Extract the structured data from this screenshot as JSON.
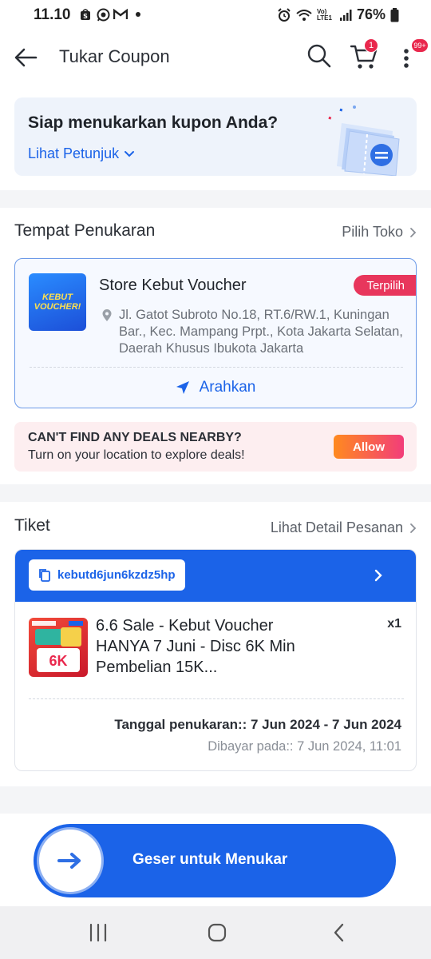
{
  "status_bar": {
    "time": "11.10",
    "battery": "76%",
    "network_label": "Vo) LTE1"
  },
  "header": {
    "title": "Tukar Coupon",
    "cart_badge": "1",
    "more_badge": "99+"
  },
  "hero": {
    "title": "Siap menukarkan kupon Anda?",
    "link": "Lihat Petunjuk"
  },
  "store_section": {
    "title": "Tempat Penukaran",
    "link": "Pilih Toko",
    "logo_text": "KEBUT VOUCHER!",
    "store_name": "Store Kebut Voucher",
    "badge": "Terpilih",
    "address": "Jl. Gatot Subroto No.18, RT.6/RW.1, Kuningan Bar., Kec. Mampang Prpt., Kota Jakarta Selatan, Daerah Khusus Ibukota Jakarta",
    "direction_label": "Arahkan"
  },
  "deals_banner": {
    "title": "CAN'T FIND ANY DEALS NEARBY?",
    "subtitle": "Turn on your location to explore deals!",
    "button": "Allow"
  },
  "ticket_section": {
    "title": "Tiket",
    "link": "Lihat Detail Pesanan",
    "code": "kebutd6jun6kzdz5hp",
    "product_title": "6.6 Sale - Kebut Voucher HANYA 7 Juni - Disc 6K Min Pembelian 15K...",
    "quantity": "x1",
    "redeem_date": "Tanggal penukaran:: 7 Jun 2024 - 7 Jun 2024",
    "paid_date": "Dibayar pada:: 7 Jun 2024, 11:01",
    "image_text": "6K"
  },
  "slider": {
    "label": "Geser untuk Menukar"
  },
  "colors": {
    "primary": "#1b63e8",
    "badge_red": "#e8365c",
    "allow_gradient_start": "#ff8a1f",
    "allow_gradient_end": "#f23d7a"
  }
}
